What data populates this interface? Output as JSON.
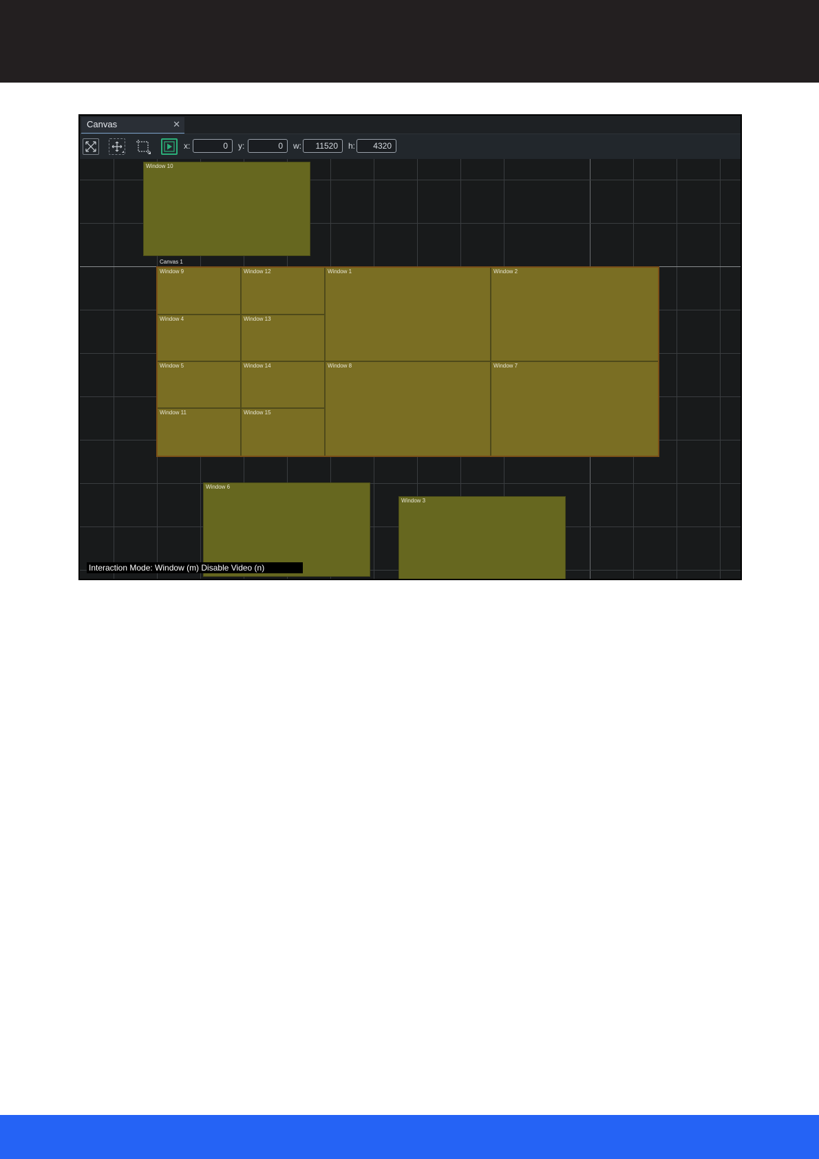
{
  "panel": {
    "tab_title": "Canvas",
    "close_glyph": "✕"
  },
  "toolbar": {
    "icons": [
      "fit-to-view-icon",
      "pan-icon",
      "crop-icon",
      "play-icon"
    ],
    "x_label": "x:",
    "x_value": "0",
    "y_label": "y:",
    "y_value": "0",
    "w_label": "w:",
    "w_value": "11520",
    "h_label": "h:",
    "h_value": "4320"
  },
  "canvas_label": "Canvas 1",
  "windows": {
    "w1": "Window 1",
    "w2": "Window 2",
    "w3": "Window 3",
    "w4": "Window 4",
    "w5": "Window 5",
    "w6": "Window 6",
    "w7": "Window 7",
    "w8": "Window 8",
    "w9": "Window 9",
    "w10": "Window 10",
    "w11": "Window 11",
    "w12": "Window 12",
    "w13": "Window 13",
    "w14": "Window 14",
    "w15": "Window 15"
  },
  "status": {
    "text": "Interaction Mode: Window (m) Disable Video (n)"
  },
  "colors": {
    "tiled_window": "#7a6e23",
    "free_window": "#66671f",
    "canvas_border": "#7a4f18",
    "accent_play": "#2bb07a",
    "footer_band": "#2563f5",
    "header_band": "#231f20"
  }
}
